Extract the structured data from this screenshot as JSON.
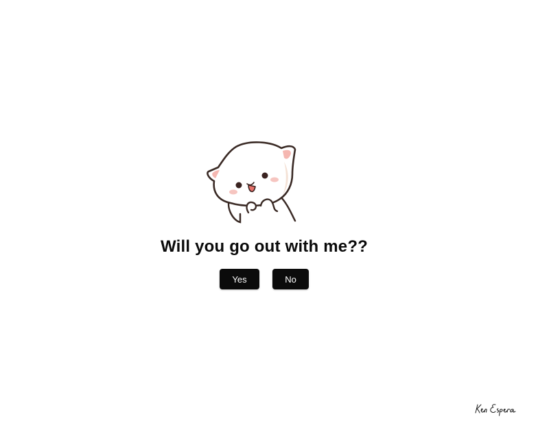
{
  "question": "Will you go out with me??",
  "buttons": {
    "yes_label": "Yes",
    "no_label": "No"
  },
  "signature": "Ken Espera",
  "icons": {
    "mascot": "cat-mascot-icon"
  },
  "colors": {
    "background": "#ffffff",
    "button_bg": "#0b0b0b",
    "button_text": "#ffffff",
    "text": "#0a0a0a"
  }
}
